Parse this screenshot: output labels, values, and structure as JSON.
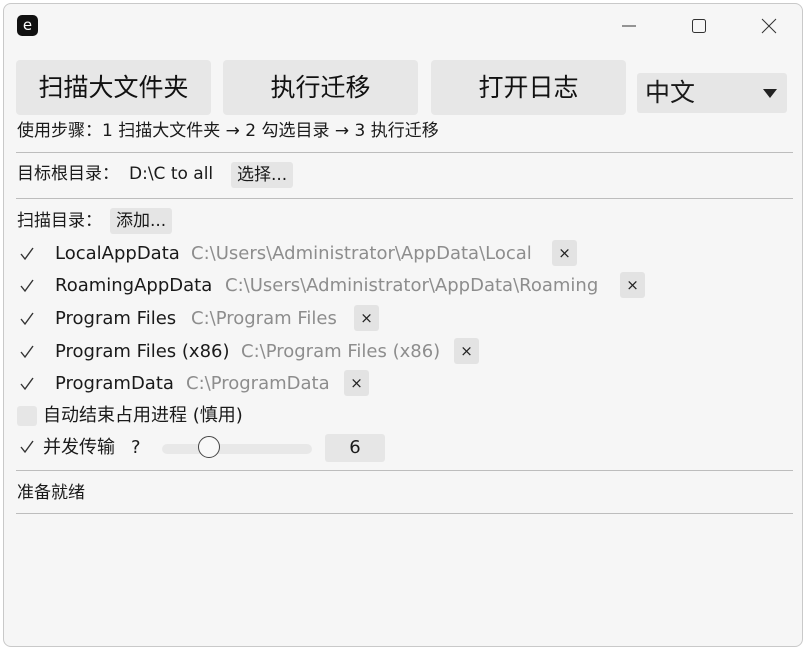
{
  "titlebar": {
    "app_icon_letter": "e"
  },
  "toolbar": {
    "scan_label": "扫描大文件夹",
    "migrate_label": "执行迁移",
    "open_log_label": "打开日志",
    "language_value": "中文"
  },
  "steps_text": "使用步骤：1 扫描大文件夹 → 2 勾选目录 → 3 执行迁移",
  "target": {
    "label": "目标根目录：",
    "value": "D:\\C to all",
    "choose_label": "选择..."
  },
  "scan_dirs": {
    "label": "扫描目录：",
    "add_label": "添加...",
    "items": [
      {
        "name": "LocalAppData",
        "path": "C:\\Users\\Administrator\\AppData\\Local",
        "checked": true
      },
      {
        "name": "RoamingAppData",
        "path": "C:\\Users\\Administrator\\AppData\\Roaming",
        "checked": true
      },
      {
        "name": "Program Files",
        "path": "C:\\Program Files",
        "checked": true
      },
      {
        "name": "Program Files (x86)",
        "path": "C:\\Program Files (x86)",
        "checked": true
      },
      {
        "name": "ProgramData",
        "path": "C:\\ProgramData",
        "checked": true
      }
    ],
    "remove_glyph": "×"
  },
  "options": {
    "auto_kill_label": "自动结束占用进程 (慎用)",
    "auto_kill_checked": false,
    "concurrency_label": "并发传输",
    "concurrency_help": "?",
    "concurrency_checked": true,
    "concurrency_value": "6"
  },
  "status": "准备就绪"
}
